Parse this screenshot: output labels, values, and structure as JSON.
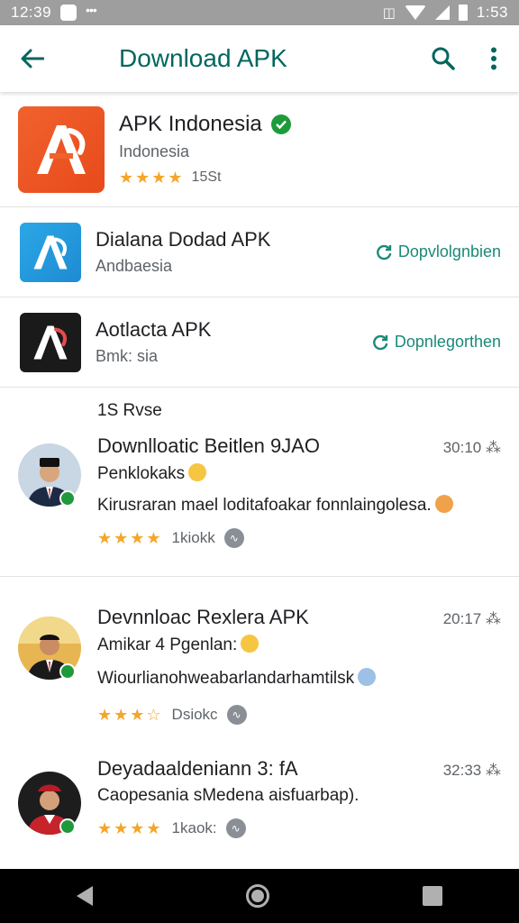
{
  "status_bar": {
    "time": "12:39",
    "right_time": "1:53"
  },
  "app_bar": {
    "title": "Download APK"
  },
  "featured_app": {
    "name": "APK Indonesia",
    "subtitle": "Indonesia",
    "stars": "★★★★",
    "rating_count": "15St",
    "brand_color": "#f0622d"
  },
  "apps": [
    {
      "name": "Dialana Dodad APK",
      "subtitle": "Andbaesia",
      "action": "Dopvlolgnbien",
      "logo": "logo-blue"
    },
    {
      "name": "Aotlacta APK",
      "subtitle": "Bmk: sia",
      "action": "Dopnlegorthen",
      "logo": "logo-dark"
    }
  ],
  "section": {
    "label": "1S Rvse"
  },
  "reviews": [
    {
      "title": "Downlloatic Beitlen 9JAO",
      "time": "30:10",
      "subtitle": "Penklokaks",
      "body": "Kirusraran mael loditafoakar fonnlaingolesa.",
      "stars": "★★★★",
      "meta": "1kiokk"
    },
    {
      "title": "Devnnloac Rexlera APK",
      "time": "20:17",
      "subtitle": "Amikar 4 Pgenlan:",
      "body": "Wiourlianohweabarlandarhamtilsk",
      "stars": "★★★☆",
      "meta": "Dsiokc"
    },
    {
      "title": "Deyadaaldeniann 3: fA",
      "time": "32:33",
      "subtitle": "Caopesania sMedena aisfuarbap).",
      "body": "",
      "stars": "★★★★",
      "meta": "1kaok:"
    }
  ],
  "colors": {
    "accent": "#01675e",
    "action": "#1a8a78",
    "star": "#f4a62a"
  }
}
